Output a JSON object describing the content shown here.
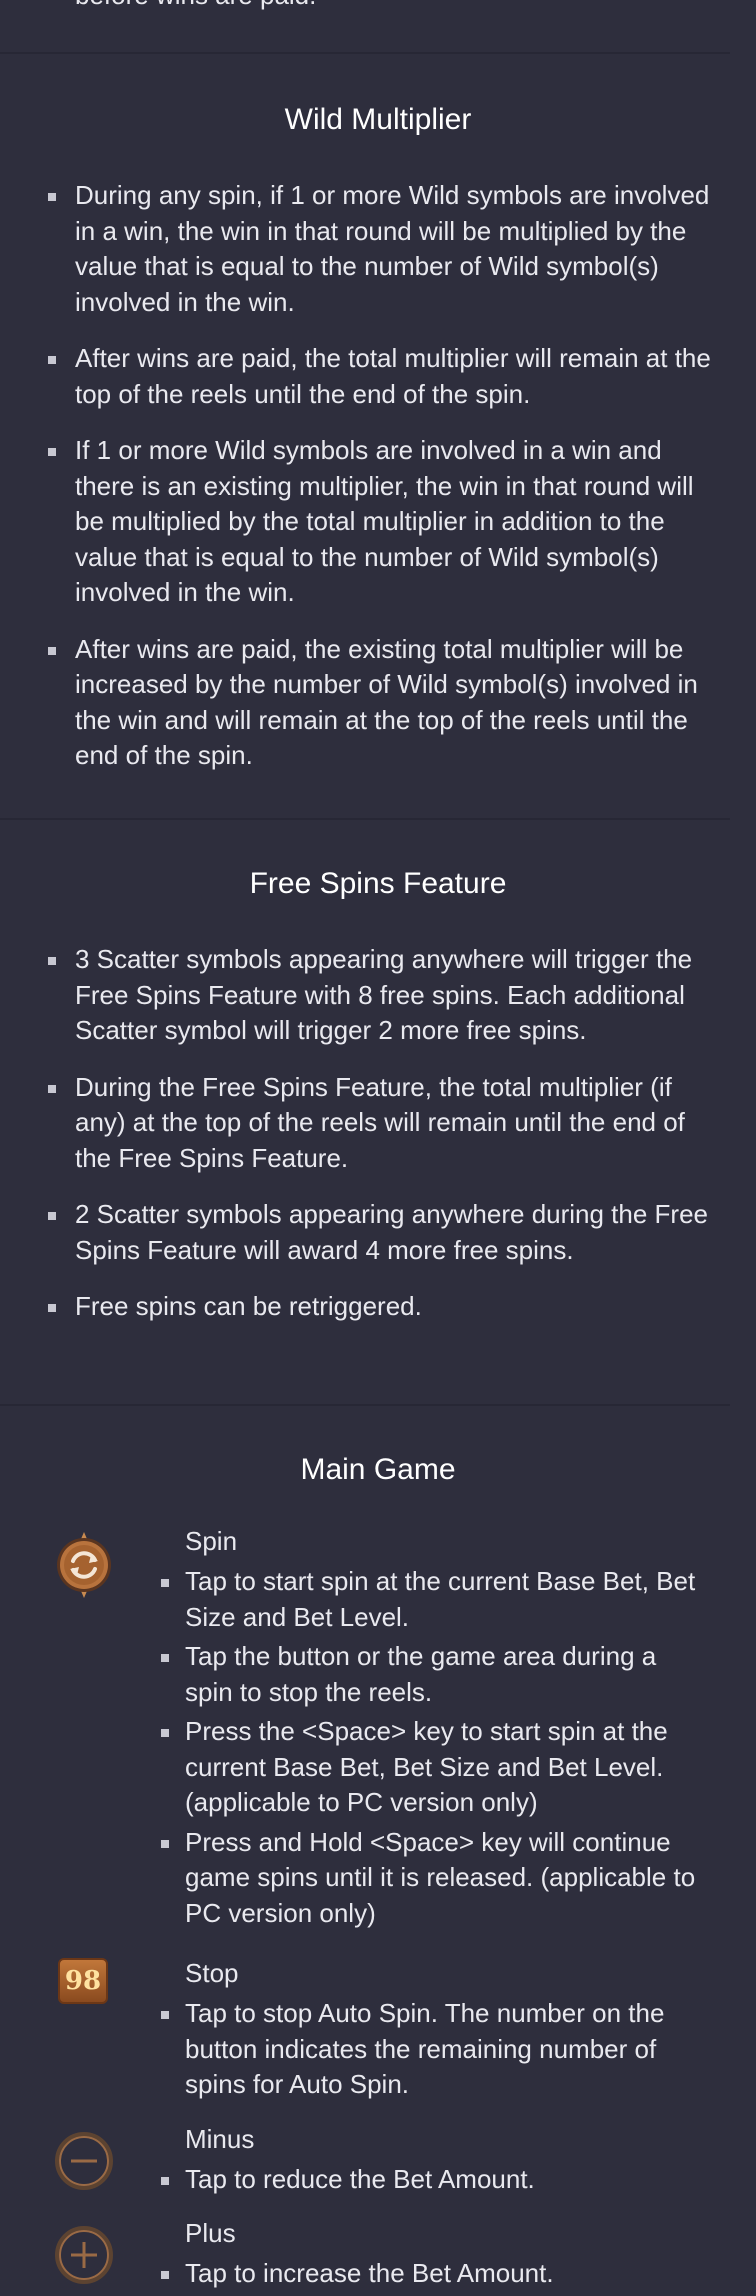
{
  "top_fragment": "before wins are paid.",
  "wild_multiplier": {
    "title": "Wild Multiplier",
    "bullets": [
      "During any spin, if 1 or more Wild symbols are involved in a win, the win in that round will be multiplied by the value that is equal to the number of Wild symbol(s) involved in the win.",
      "After wins are paid, the total multiplier will remain at the top of the reels until the end of the spin.",
      "If 1 or more Wild symbols are involved in a win and there is an existing multiplier, the win in that round will be multiplied by the total multiplier in addition to the value that is equal to the number of Wild symbol(s) involved in the win.",
      "After wins are paid, the existing total multiplier will be increased by the number of Wild symbol(s) involved in the win and will remain at the top of the reels until the end of the spin."
    ]
  },
  "free_spins": {
    "title": "Free Spins Feature",
    "bullets": [
      "3 Scatter symbols appearing anywhere will trigger the Free Spins Feature with 8 free spins. Each additional Scatter symbol will trigger 2 more free spins.",
      "During the Free Spins Feature, the total multiplier (if any) at the top of the reels will remain until the end of the Free Spins Feature.",
      "2 Scatter symbols appearing anywhere during the Free Spins Feature will award 4 more free spins.",
      "Free spins can be retriggered."
    ]
  },
  "main_game": {
    "title": "Main Game",
    "spin": {
      "name": "Spin",
      "icon": "spin-icon",
      "bullets": [
        "Tap to start spin at the current Base Bet, Bet Size and Bet Level.",
        "Tap the button or the game area during a spin to stop the reels.",
        "Press the <Space> key to start spin at the current Base Bet, Bet Size and Bet Level. (applicable to PC version only)",
        "Press and Hold <Space> key will continue game spins until it is released. (applicable to PC version only)"
      ]
    },
    "stop": {
      "name": "Stop",
      "badge": "98",
      "bullets": [
        "Tap to stop Auto Spin. The number on the button indicates the remaining number of spins for Auto Spin."
      ]
    },
    "minus": {
      "name": "Minus",
      "icon": "minus-icon",
      "bullets": [
        "Tap to reduce the Bet Amount."
      ]
    },
    "plus": {
      "name": "Plus",
      "icon": "plus-icon",
      "bullets": [
        "Tap to increase the Bet Amount."
      ]
    }
  },
  "colors": {
    "background": "#2e2e3d",
    "divider": "#272735",
    "icon_copper": "#b8733d"
  }
}
